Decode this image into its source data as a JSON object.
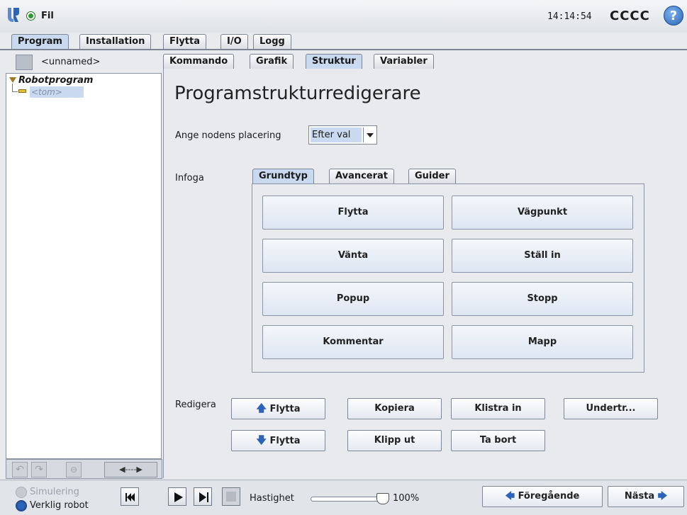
{
  "header": {
    "menu_label": "Fil",
    "clock": "14:14:54",
    "robot_name": "CCCC",
    "help_label": "?"
  },
  "main_tabs": [
    "Program",
    "Installation",
    "Flytta",
    "I/O",
    "Logg"
  ],
  "program": {
    "file_name": "<unnamed>",
    "tree": {
      "root": "Robotprogram",
      "child": "<tom>"
    }
  },
  "sub_tabs": [
    "Kommando",
    "Grafik",
    "Struktur",
    "Variabler"
  ],
  "editor": {
    "title": "Programstrukturredigerare",
    "placement_label": "Ange nodens placering",
    "placement_value": "Efter val",
    "insert_label": "Infoga",
    "insert_tabs": [
      "Grundtyp",
      "Avancerat",
      "Guider"
    ],
    "insert_buttons": [
      "Flytta",
      "Vägpunkt",
      "Vänta",
      "Ställ in",
      "Popup",
      "Stopp",
      "Kommentar",
      "Mapp"
    ],
    "edit_label": "Redigera",
    "edit_buttons": {
      "move_up": "Flytta",
      "copy": "Kopiera",
      "paste": "Klistra in",
      "suppress": "Undertr...",
      "move_down": "Flytta",
      "cut": "Klipp ut",
      "delete": "Ta bort"
    }
  },
  "footer": {
    "simulation": "Simulering",
    "real_robot": "Verklig robot",
    "speed_label": "Hastighet",
    "speed_value": "100%",
    "speed_fraction": 1.0,
    "prev": "Föregående",
    "next": "Nästa"
  },
  "colors": {
    "accent": "#2b64b8",
    "selected": "#c9daf0",
    "run_green": "#2e9b2e"
  }
}
